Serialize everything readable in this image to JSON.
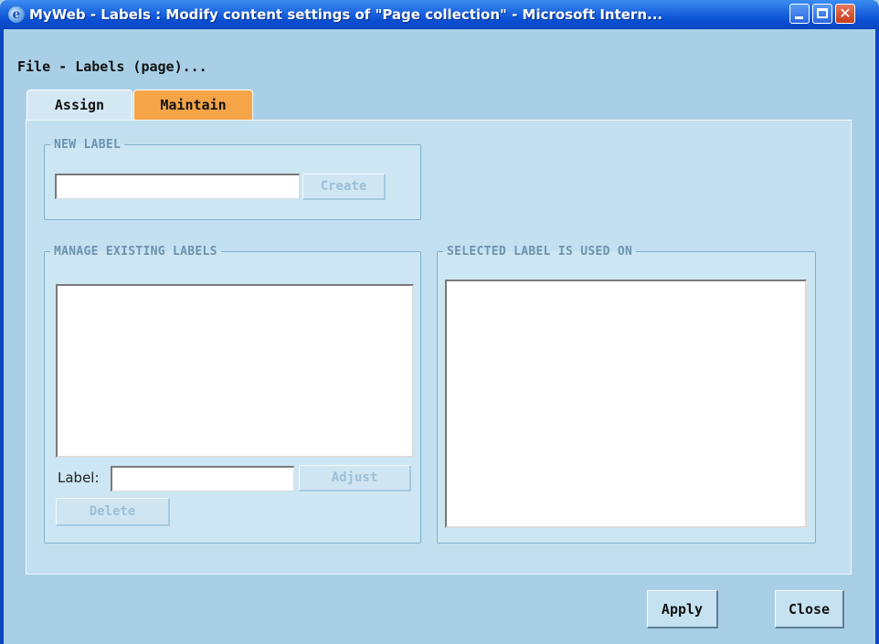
{
  "window": {
    "title": "MyWeb - Labels : Modify content settings of \"Page collection\" - Microsoft Intern...",
    "ie_icon_glyph": "e",
    "close_glyph": "✕"
  },
  "header": {
    "text": "File - Labels (page)..."
  },
  "tabs": [
    {
      "label": "Assign",
      "active": false
    },
    {
      "label": "Maintain",
      "active": true
    }
  ],
  "new_label": {
    "legend": "NEW LABEL",
    "input_value": "",
    "create_button": "Create"
  },
  "manage": {
    "legend": "MANAGE EXISTING LABELS",
    "items": [],
    "label_prefix": "Label:",
    "label_value": "",
    "adjust_button": "Adjust",
    "delete_button": "Delete"
  },
  "used_on": {
    "legend": "SELECTED LABEL IS USED ON",
    "items": []
  },
  "footer": {
    "apply_button": "Apply",
    "close_button": "Close"
  },
  "colors": {
    "titlebar": "#0b47c1",
    "background": "#a8cfe6",
    "panel": "#c2e0f0",
    "active_tab": "#f5a447",
    "inactive_tab": "#d4e8f4"
  },
  "icons": [
    "ie-icon",
    "minimize-icon",
    "maximize-icon",
    "close-icon"
  ]
}
